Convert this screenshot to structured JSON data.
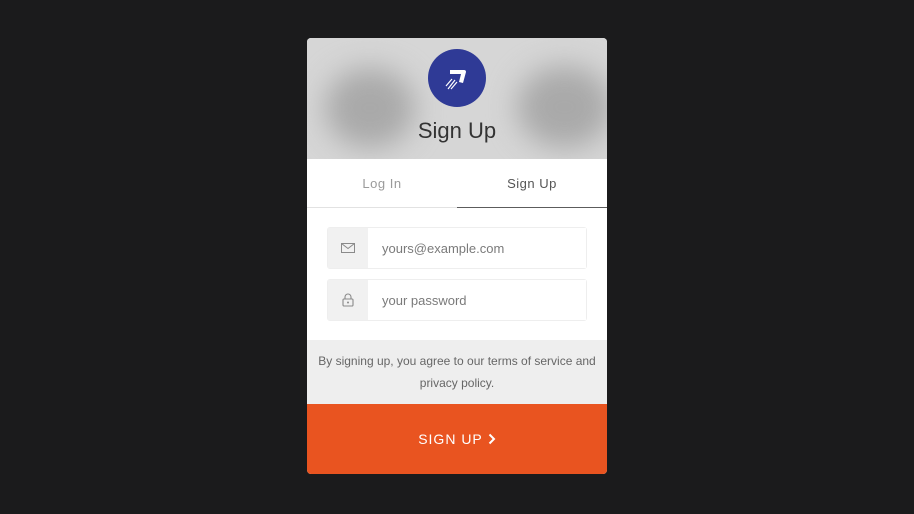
{
  "header": {
    "title": "Sign Up",
    "logo_icon": "boomerang-icon",
    "logo_color": "#2f3a96"
  },
  "tabs": [
    {
      "label": "Log In",
      "active": false
    },
    {
      "label": "Sign Up",
      "active": true
    }
  ],
  "form": {
    "email": {
      "placeholder": "yours@example.com",
      "value": "",
      "icon": "envelope-icon"
    },
    "password": {
      "placeholder": "your password",
      "value": "",
      "icon": "lock-icon"
    }
  },
  "terms": {
    "text": "By signing up, you agree to our terms of service and privacy policy."
  },
  "submit": {
    "label": "SIGN UP",
    "icon": "chevron-right-icon",
    "color": "#e95420"
  }
}
